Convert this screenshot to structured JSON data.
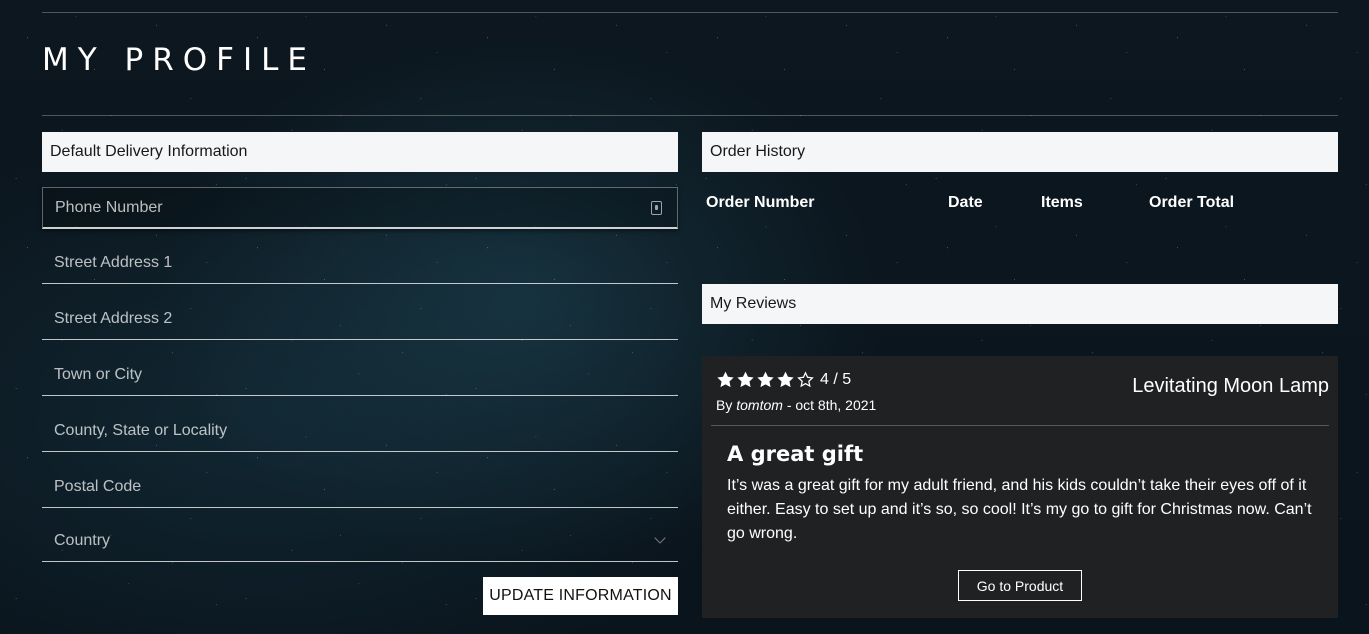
{
  "page": {
    "title": "MY PROFILE"
  },
  "delivery": {
    "header": "Default Delivery Information",
    "fields": {
      "phone": {
        "placeholder": "Phone Number",
        "value": ""
      },
      "street1": {
        "placeholder": "Street Address 1",
        "value": ""
      },
      "street2": {
        "placeholder": "Street Address 2",
        "value": ""
      },
      "city": {
        "placeholder": "Town or City",
        "value": ""
      },
      "county": {
        "placeholder": "County, State or Locality",
        "value": ""
      },
      "postal": {
        "placeholder": "Postal Code",
        "value": ""
      },
      "country": {
        "selected": "Country"
      }
    },
    "update_label": "UPDATE INFORMATION"
  },
  "orders": {
    "header": "Order History",
    "columns": [
      "Order Number",
      "Date",
      "Items",
      "Order Total"
    ],
    "rows": []
  },
  "reviews": {
    "header": "My Reviews",
    "items": [
      {
        "rating": 4,
        "max_rating": 5,
        "rating_text": "4 / 5",
        "by_prefix": "By",
        "author": "tomtom",
        "date_text": "- oct 8th, 2021",
        "product": "Levitating Moon Lamp",
        "title": "A great gift",
        "body": "It’s was a great gift for my adult friend, and his kids couldn’t take their eyes off of it either. Easy to set up and it’s so, so cool! It’s my go to gift for Christmas now. Can’t go wrong.",
        "button_label": "Go to Product"
      }
    ]
  },
  "icons": {
    "star_filled": "star-icon",
    "star_empty": "star-outline-icon",
    "contact_card": "contact-card-icon",
    "chevron": "chevron-down-icon"
  },
  "colors": {
    "header_bg": "#f4f6f8",
    "card_bg": "#1f2123",
    "page_bg": "#0c171f"
  }
}
